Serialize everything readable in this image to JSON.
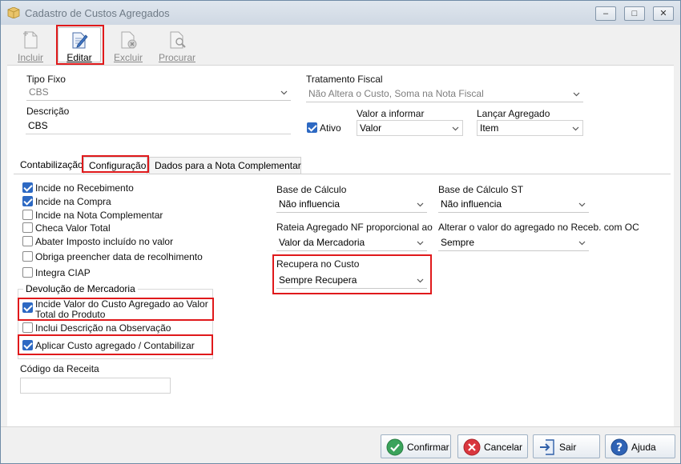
{
  "window": {
    "title": "Cadastro de Custos Agregados",
    "minimize": "–",
    "maximize": "□",
    "close": "✕"
  },
  "toolbar": {
    "incluir": "Incluir",
    "editar": "Editar",
    "excluir": "Excluir",
    "procurar": "Procurar"
  },
  "form": {
    "tipo_fixo_label": "Tipo Fixo",
    "tipo_fixo_value": "CBS",
    "tratamento_label": "Tratamento Fiscal",
    "tratamento_value": "Não Altera o Custo, Soma na Nota Fiscal",
    "descricao_label": "Descrição",
    "descricao_value": "CBS",
    "ativo_label": "Ativo",
    "valor_informar_label": "Valor a informar",
    "valor_informar_value": "Valor",
    "lancar_label": "Lançar Agregado",
    "lancar_value": "Item"
  },
  "tabs": {
    "contabilizacao": "Contabilização",
    "configuracao": "Configuração",
    "dados_nota": "Dados para a Nota Complementar"
  },
  "config": {
    "checks": {
      "incide_recebimento": "Incide no Recebimento",
      "incide_compra": "Incide na Compra",
      "incide_nota_compl": "Incide na Nota Complementar",
      "checa_valor_total": "Checa Valor Total",
      "abater_imposto": "Abater Imposto incluído no valor",
      "obriga_data": "Obriga preencher data de recolhimento",
      "integra_ciap": "Integra CIAP"
    },
    "devolucao_title": "Devolução de Mercadoria",
    "devolucao": {
      "incide_valor_line1": "Incide Valor do Custo Agregado ao Valor",
      "incide_valor_line2": "Total do Produto",
      "inclui_descricao": "Inclui Descrição na Observação",
      "aplicar_custo": "Aplicar Custo agregado / Contabilizar"
    },
    "codigo_receita_label": "Código da Receita",
    "codigo_receita_value": "",
    "base_calculo_label": "Base de Cálculo",
    "base_calculo_value": "Não influencia",
    "base_calculo_st_label": "Base de Cálculo ST",
    "base_calculo_st_value": "Não influencia",
    "rateia_label": "Rateia Agregado NF proporcional ao",
    "rateia_value": "Valor da Mercadoria",
    "alterar_label": "Alterar o valor do agregado no Receb. com OC",
    "alterar_value": "Sempre",
    "recupera_label": "Recupera no Custo",
    "recupera_value": "Sempre Recupera"
  },
  "footer": {
    "confirmar": "Confirmar",
    "cancelar": "Cancelar",
    "sair": "Sair",
    "ajuda": "Ajuda"
  },
  "colors": {
    "accent": "#2d69c3",
    "highlight": "#e0191b"
  }
}
